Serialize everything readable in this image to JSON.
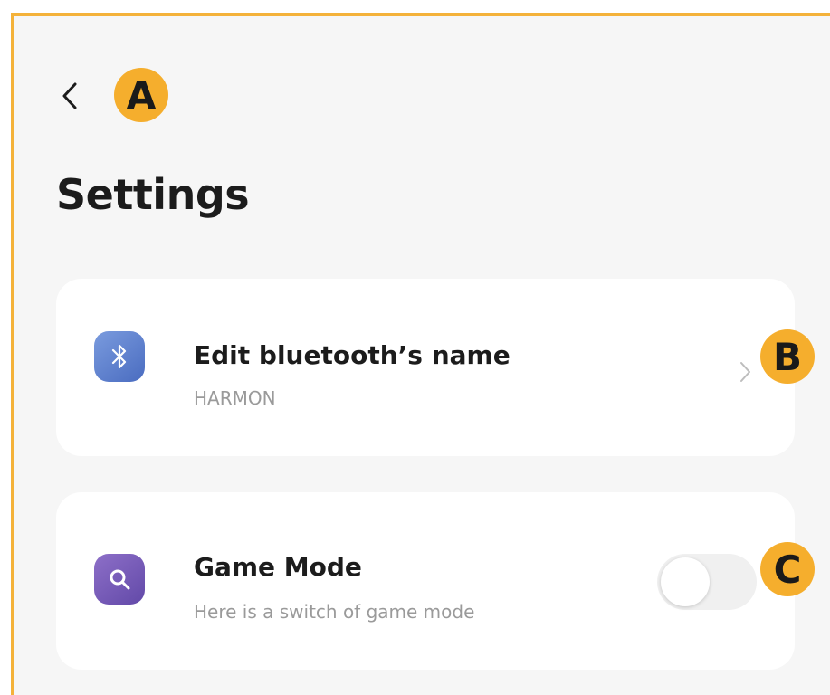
{
  "header": {
    "title": "Settings",
    "back_icon": "chevron-left-icon"
  },
  "callouts": {
    "a": "A",
    "b": "B",
    "c": "C"
  },
  "settings": {
    "bluetooth": {
      "title": "Edit bluetooth’s name",
      "subtitle": "HARMON",
      "icon": "bluetooth-icon",
      "accessory": "chevron-right-icon"
    },
    "game_mode": {
      "title": "Game Mode",
      "subtitle": "Here is a switch of game mode",
      "icon": "game-mode-icon",
      "toggle_on": false
    }
  },
  "colors": {
    "callout": "#f5ae2d",
    "frame_border": "#f4b23a",
    "background": "#f6f6f6",
    "bluetooth_icon": "#5a7bcb",
    "game_icon": "#7459b6"
  }
}
